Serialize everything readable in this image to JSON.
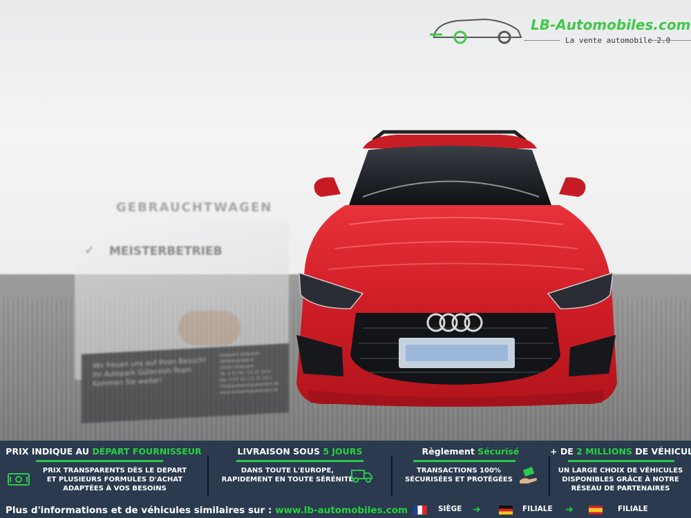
{
  "logo": {
    "brand": "LB-Automobiles.com",
    "tagline": "La vente automobile 2.0"
  },
  "photo": {
    "sign_title": "GEBRAUCHTWAGEN",
    "sign_subtitle": "MEISTERBETRIEB",
    "board_lines": [
      "Wir freuen uns auf Ihren Besuch!",
      "Ihr Autopark Gütersloh-Team",
      "Kommen Sie weiter!"
    ],
    "address_lines": [
      "Autopark Gütersloh",
      "Wilhelmstraße 8",
      "33332 Gütersloh",
      "Tel. 0 52 41 / 21 21 10-0",
      "Fax. 0 52 41 / 21 21 10-1",
      "info@autoparkguetersloh.de",
      "www.autoparkguetersloh.de"
    ]
  },
  "features": [
    {
      "title_pre": "PRIX INDIQUE AU ",
      "title_hl": "DÉPART FOURNISSEUR",
      "title_post": "",
      "text": "PRIX TRANSPARENTS DÈS LE DEPART\nET PLUSIEURS FORMULES D'ACHAT\nADAPTÉES À VOS BESOINS",
      "icon": "cash-icon"
    },
    {
      "title_pre": "LIVRAISON SOUS ",
      "title_hl": "5 JOURS",
      "title_post": "",
      "text": "DANS TOUTE L'EUROPE,\nRAPIDEMENT EN TOUTE SÉRÉNITÉ",
      "icon": "truck-icon"
    },
    {
      "title_pre": "Règlement ",
      "title_hl": "Sécurisé",
      "title_post": "",
      "text": "TRANSACTIONS 100%\nSÉCURISÉES ET PROTÉGÉES",
      "icon": "payment-hand-icon"
    },
    {
      "title_pre": "+ DE ",
      "title_hl": "2 MILLIONS",
      "title_post": " DE VÉHICULES",
      "text": "UN LARGE CHOIX DE VÉHICULES\nDISPONIBLES GRÂCE À NOTRE\nRÉSEAU DE PARTENAIRES",
      "icon": ""
    }
  ],
  "footer": {
    "prefix": "Plus d'informations et de véhicules similaires sur : ",
    "url": "www.lb-automobiles.com",
    "flags": [
      {
        "label": "SIÈGE",
        "country": "France"
      },
      {
        "label": "FILIALE",
        "country": "Germany"
      },
      {
        "label": "FILIALE",
        "country": "Spain"
      }
    ]
  },
  "colors": {
    "accent": "#27d13f",
    "bar": "#2b3a4e",
    "car": "#d61e27"
  }
}
